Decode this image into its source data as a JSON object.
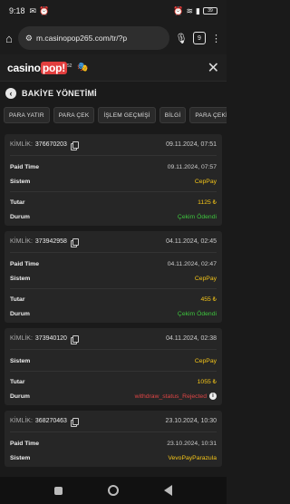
{
  "status": {
    "time": "9:18",
    "battery": "39"
  },
  "browser": {
    "url": "m.casinopop265.com/tr/?p",
    "tab_count": "9"
  },
  "site": {
    "logo_a": "casino",
    "logo_b": "pop!",
    "logo_sup": "52"
  },
  "page": {
    "title": "BAKİYE YÖNETİMİ"
  },
  "tabs": [
    "PARA YATIR",
    "PARA ÇEK",
    "İŞLEM GEÇMİŞİ",
    "BİLGİ",
    "PARA ÇEKİŞ"
  ],
  "labels": {
    "kimlik": "KİMLİK:",
    "paid_time": "Paid Time",
    "sistem": "Sistem",
    "tutar": "Tutar",
    "durum": "Durum"
  },
  "transactions": [
    {
      "id": "376670203",
      "date": "09.11.2024, 07:51",
      "paid_time": "09.11.2024, 07:57",
      "system": "CepPay",
      "amount": "1125 ₺",
      "status": "Çekim Ödendi"
    },
    {
      "id": "373942958",
      "date": "04.11.2024, 02:45",
      "paid_time": "04.11.2024, 02:47",
      "system": "CepPay",
      "amount": "455 ₺",
      "status": "Çekim Ödendi"
    },
    {
      "id": "373940120",
      "date": "04.11.2024, 02:38",
      "system": "CepPay",
      "amount": "1055 ₺",
      "status": "withdraw_status_Rejected"
    },
    {
      "id": "368270463",
      "date": "23.10.2024, 10:30",
      "paid_time": "23.10.2024, 10:31",
      "system": "VevoPayParazula"
    }
  ],
  "colors": {
    "amount": "#f5c518",
    "paid": "#3ec43e",
    "rejected": "#e04545"
  }
}
